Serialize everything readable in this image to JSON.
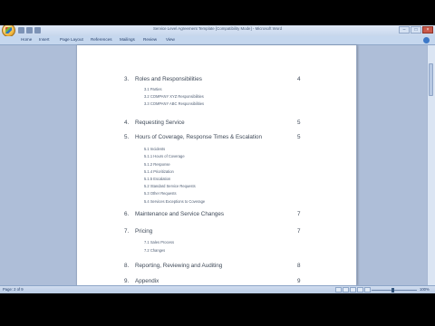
{
  "window": {
    "title": "Service Level Agreement Template [Compatibility Mode] - Microsoft Word"
  },
  "ribbon": {
    "tabs": [
      "Home",
      "Insert",
      "Page Layout",
      "References",
      "Mailings",
      "Review",
      "View"
    ]
  },
  "toc": [
    {
      "num": "3.",
      "title": "Roles and Responsibilities",
      "page": "4",
      "subs": [
        "3.1  Parties",
        "3.2  COMPANY XYZ Responsibilities",
        "3.3  COMPANY ABC Responsibilities"
      ]
    },
    {
      "num": "4.",
      "title": "Requesting Service",
      "page": "5",
      "subs": []
    },
    {
      "num": "5.",
      "title": "Hours of Coverage, Response Times & Escalation",
      "page": "5",
      "subs": [
        "5.1  Incidents",
        "5.1.1  Hours of Coverage",
        "5.1.2  Response",
        "5.1.4  Prioritization",
        "5.1.5  Escalation",
        "5.2  Standard Service Requests",
        "5.3  Other Requests",
        "5.4  Services Exceptions to Coverage"
      ]
    },
    {
      "num": "6.",
      "title": "Maintenance and Service Changes",
      "page": "7",
      "subs": []
    },
    {
      "num": "7.",
      "title": "Pricing",
      "page": "7",
      "subs": [
        "7.1  Sales Process",
        "7.2  Changes"
      ]
    },
    {
      "num": "8.",
      "title": "Reporting, Reviewing and Auditing",
      "page": "8",
      "subs": []
    },
    {
      "num": "9.",
      "title": "Appendix",
      "page": "9",
      "subs": []
    }
  ],
  "statusbar": {
    "page_info": "Page: 2 of 9",
    "zoom": "100%"
  },
  "icons": {
    "office_button": "office-logo-icon",
    "help": "help-icon"
  }
}
